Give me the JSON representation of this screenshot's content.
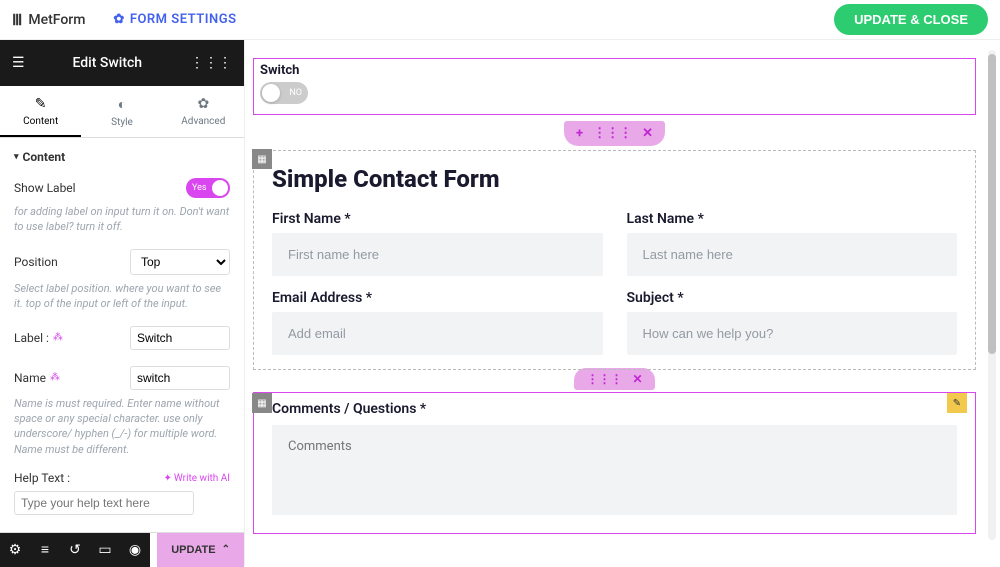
{
  "topbar": {
    "logo_text": "MetForm",
    "settings_text": "FORM SETTINGS",
    "update_close": "UPDATE & CLOSE"
  },
  "panel": {
    "title": "Edit Switch",
    "tabs": {
      "content": "Content",
      "style": "Style",
      "advanced": "Advanced"
    },
    "section": "Content",
    "show_label": {
      "label": "Show Label",
      "value": "Yes",
      "help": "for adding label on input turn it on. Don't want to use label? turn it off."
    },
    "position": {
      "label": "Position",
      "value": "Top",
      "help": "Select label position. where you want to see it. top of the input or left of the input."
    },
    "label_field": {
      "label": "Label :",
      "value": "Switch"
    },
    "name_field": {
      "label": "Name",
      "value": "switch",
      "help": "Name is must required. Enter name without space or any special character. use only underscore/ hyphen (_/-) for multiple word. Name must be different."
    },
    "help_text": {
      "label": "Help Text :",
      "placeholder": "Type your help text here",
      "ai": "Write with AI"
    },
    "footer": {
      "update": "UPDATE"
    }
  },
  "canvas": {
    "switch": {
      "label": "Switch",
      "value": "NO"
    },
    "heading": "Simple Contact Form",
    "fields": {
      "first_name": {
        "label": "First Name *",
        "placeholder": "First name here"
      },
      "last_name": {
        "label": "Last Name *",
        "placeholder": "Last name here"
      },
      "email": {
        "label": "Email Address *",
        "placeholder": "Add email"
      },
      "subject": {
        "label": "Subject *",
        "placeholder": "How can we help you?"
      }
    },
    "comments": {
      "label": "Comments / Questions *",
      "placeholder": "Comments"
    }
  }
}
